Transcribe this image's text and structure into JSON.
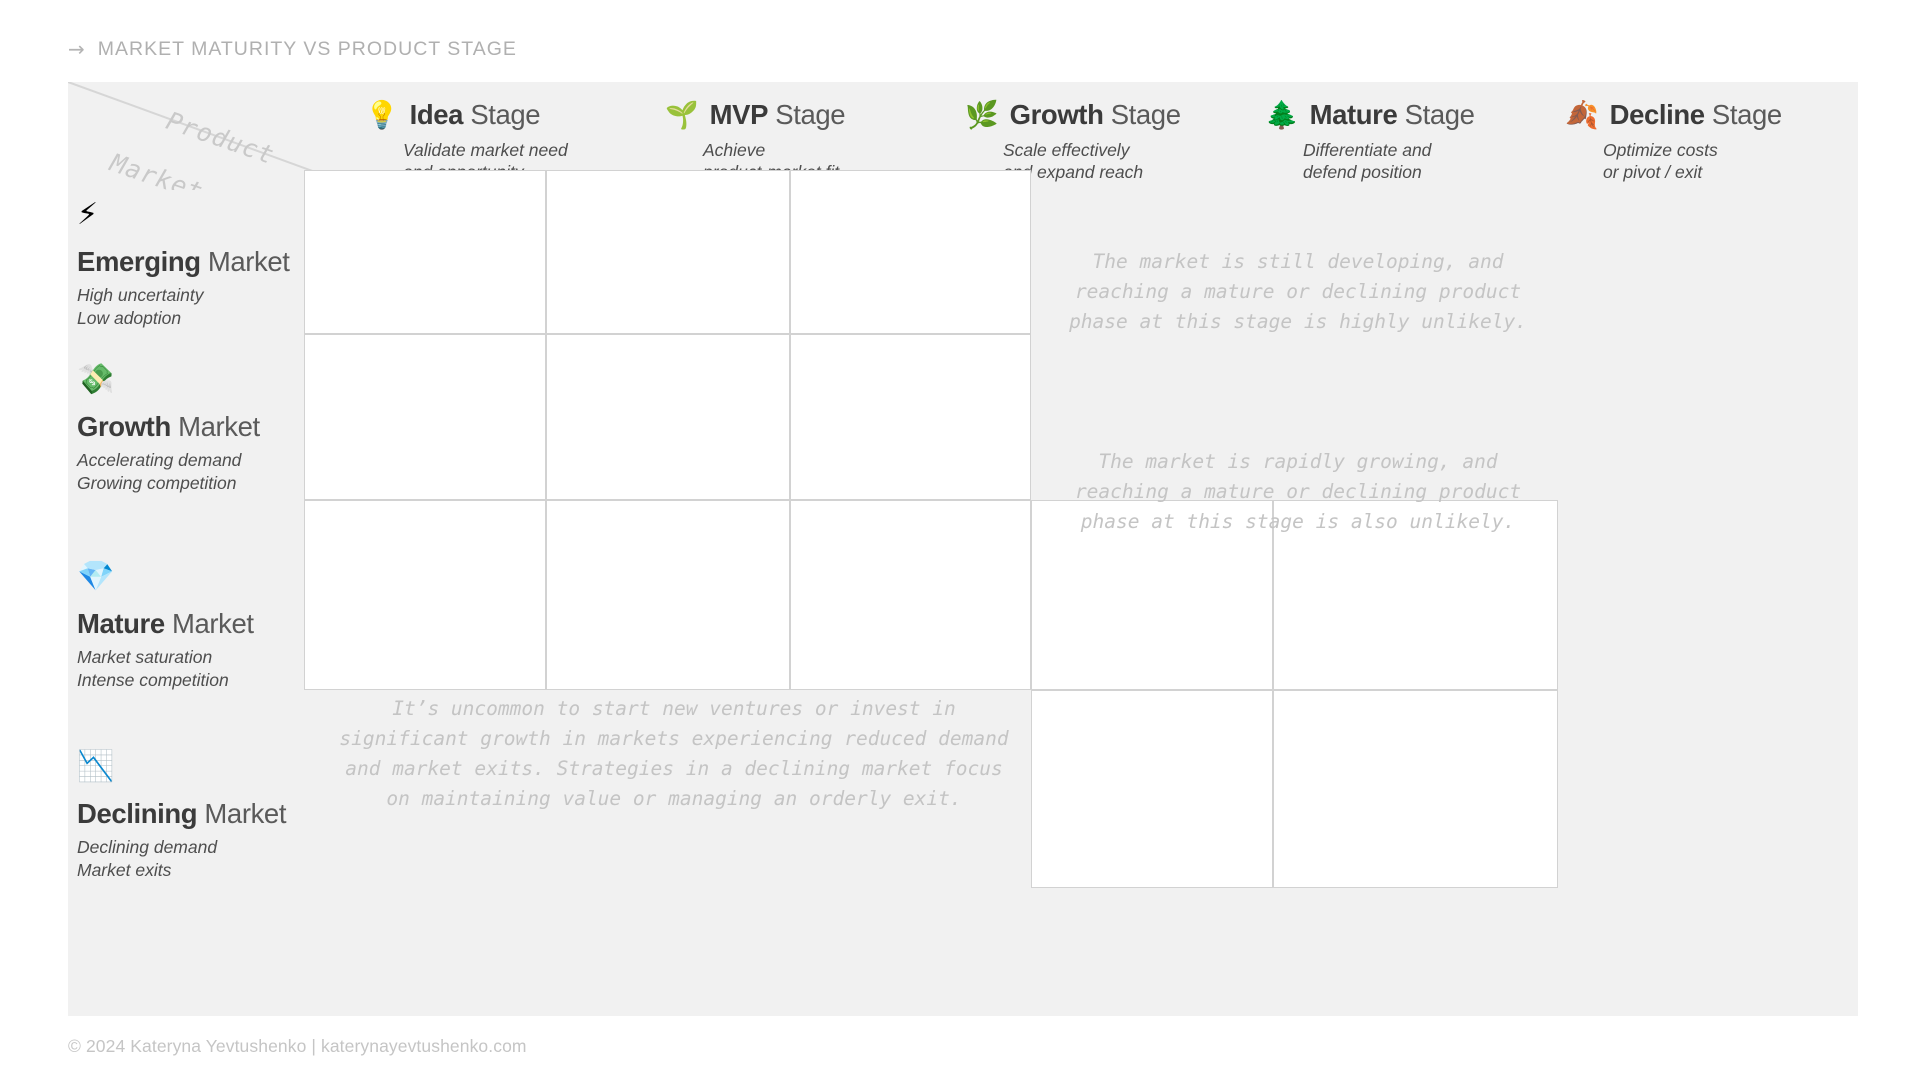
{
  "breadcrumb": {
    "arrow_icon": "arrow-right-icon",
    "label": "MARKET MATURITY VS PRODUCT STAGE"
  },
  "matrix": {
    "corner": {
      "product_label": "Product",
      "market_label": "Market"
    },
    "columns": [
      {
        "icon": "light-bulb-icon",
        "emoji": "💡",
        "name": "Idea",
        "suffix": "Stage",
        "subtitle": "Validate market need\nand opportunity"
      },
      {
        "icon": "seedling-icon",
        "emoji": "🌱",
        "name": "MVP",
        "suffix": "Stage",
        "subtitle": "Achieve\nproduct-market fit"
      },
      {
        "icon": "herb-icon",
        "emoji": "🌿",
        "name": "Growth",
        "suffix": "Stage",
        "subtitle": "Scale effectively\nand expand reach"
      },
      {
        "icon": "evergreen-tree-icon",
        "emoji": "🌲",
        "name": "Mature",
        "suffix": "Stage",
        "subtitle": "Differentiate and\ndefend position"
      },
      {
        "icon": "fallen-leaf-icon",
        "emoji": "🍂",
        "name": "Decline",
        "suffix": "Stage",
        "subtitle": "Optimize costs\nor pivot / exit"
      }
    ],
    "rows": [
      {
        "icon": "high-voltage-icon",
        "emoji": "⚡",
        "name": "Emerging",
        "suffix": "Market",
        "subtitle": "High uncertainty\nLow adoption"
      },
      {
        "icon": "money-with-wings-icon",
        "emoji": "💸",
        "name": "Growth",
        "suffix": "Market",
        "subtitle": "Accelerating demand\nGrowing competition"
      },
      {
        "icon": "gem-stone-icon",
        "emoji": "💎",
        "name": "Mature",
        "suffix": "Market",
        "subtitle": "Market saturation\nIntense competition"
      },
      {
        "icon": "chart-decreasing-icon",
        "emoji": "📉",
        "name": "Declining",
        "suffix": "Market",
        "subtitle": "Declining demand\nMarket exits"
      }
    ],
    "notes": {
      "emerging_mature_decline": "The market is still developing, and\nreaching a mature or declining product\nphase at this stage is highly unlikely.",
      "growth_mature_decline": "The market is rapidly growing, and\nreaching a mature or declining product\nphase at this stage is also unlikely.",
      "declining_idea_growth": "It’s uncommon to start new ventures or invest in\nsignificant growth in markets experiencing reduced demand\nand market exits. Strategies in a declining market focus\non maintaining value or managing an orderly exit."
    }
  },
  "footer": {
    "text": "© 2024 Kateryna Yevtushenko | katerynayevtushenko.com"
  },
  "colors": {
    "panel_background": "#f1f1f1",
    "cell_background": "#ffffff",
    "cell_border": "#d2d2d2",
    "title_bold": "#3b3b3b",
    "title_light": "#5a5a5a",
    "note_text": "#c4c4c4",
    "muted": "#b0b0b0"
  }
}
